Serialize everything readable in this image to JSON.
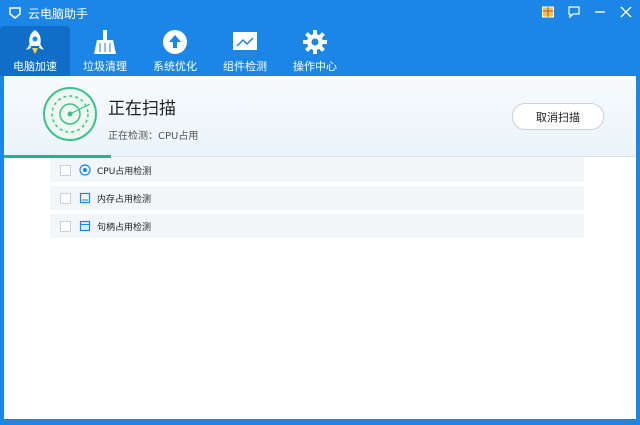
{
  "window": {
    "app_title": "云电脑助手",
    "controls": [
      {
        "icon": "gift-icon"
      },
      {
        "icon": "message-icon"
      },
      {
        "icon": "minimize-icon"
      },
      {
        "icon": "close-icon"
      }
    ]
  },
  "nav": {
    "tabs": [
      {
        "label": "电脑加速",
        "icon": "rocket-icon",
        "active": true
      },
      {
        "label": "垃圾清理",
        "icon": "broom-icon",
        "active": false
      },
      {
        "label": "系统优化",
        "icon": "upload-icon",
        "active": false
      },
      {
        "label": "组件检测",
        "icon": "monitor-icon",
        "active": false
      },
      {
        "label": "操作中心",
        "icon": "gear-icon",
        "active": false
      }
    ]
  },
  "scan": {
    "title": "正在扫描",
    "status": "正在检测：CPU占用",
    "cancel_label": "取消扫描",
    "progress_fraction": 0.17
  },
  "checks": [
    {
      "label": "CPU占用检测",
      "icon": "cpu-icon"
    },
    {
      "label": "内存占用检测",
      "icon": "memory-icon"
    },
    {
      "label": "句柄占用检测",
      "icon": "handle-icon"
    }
  ],
  "colors": {
    "titlebar_blue": "#1b86e6",
    "active_tab": "#0f6fc8",
    "accent_green": "#24b28a"
  }
}
